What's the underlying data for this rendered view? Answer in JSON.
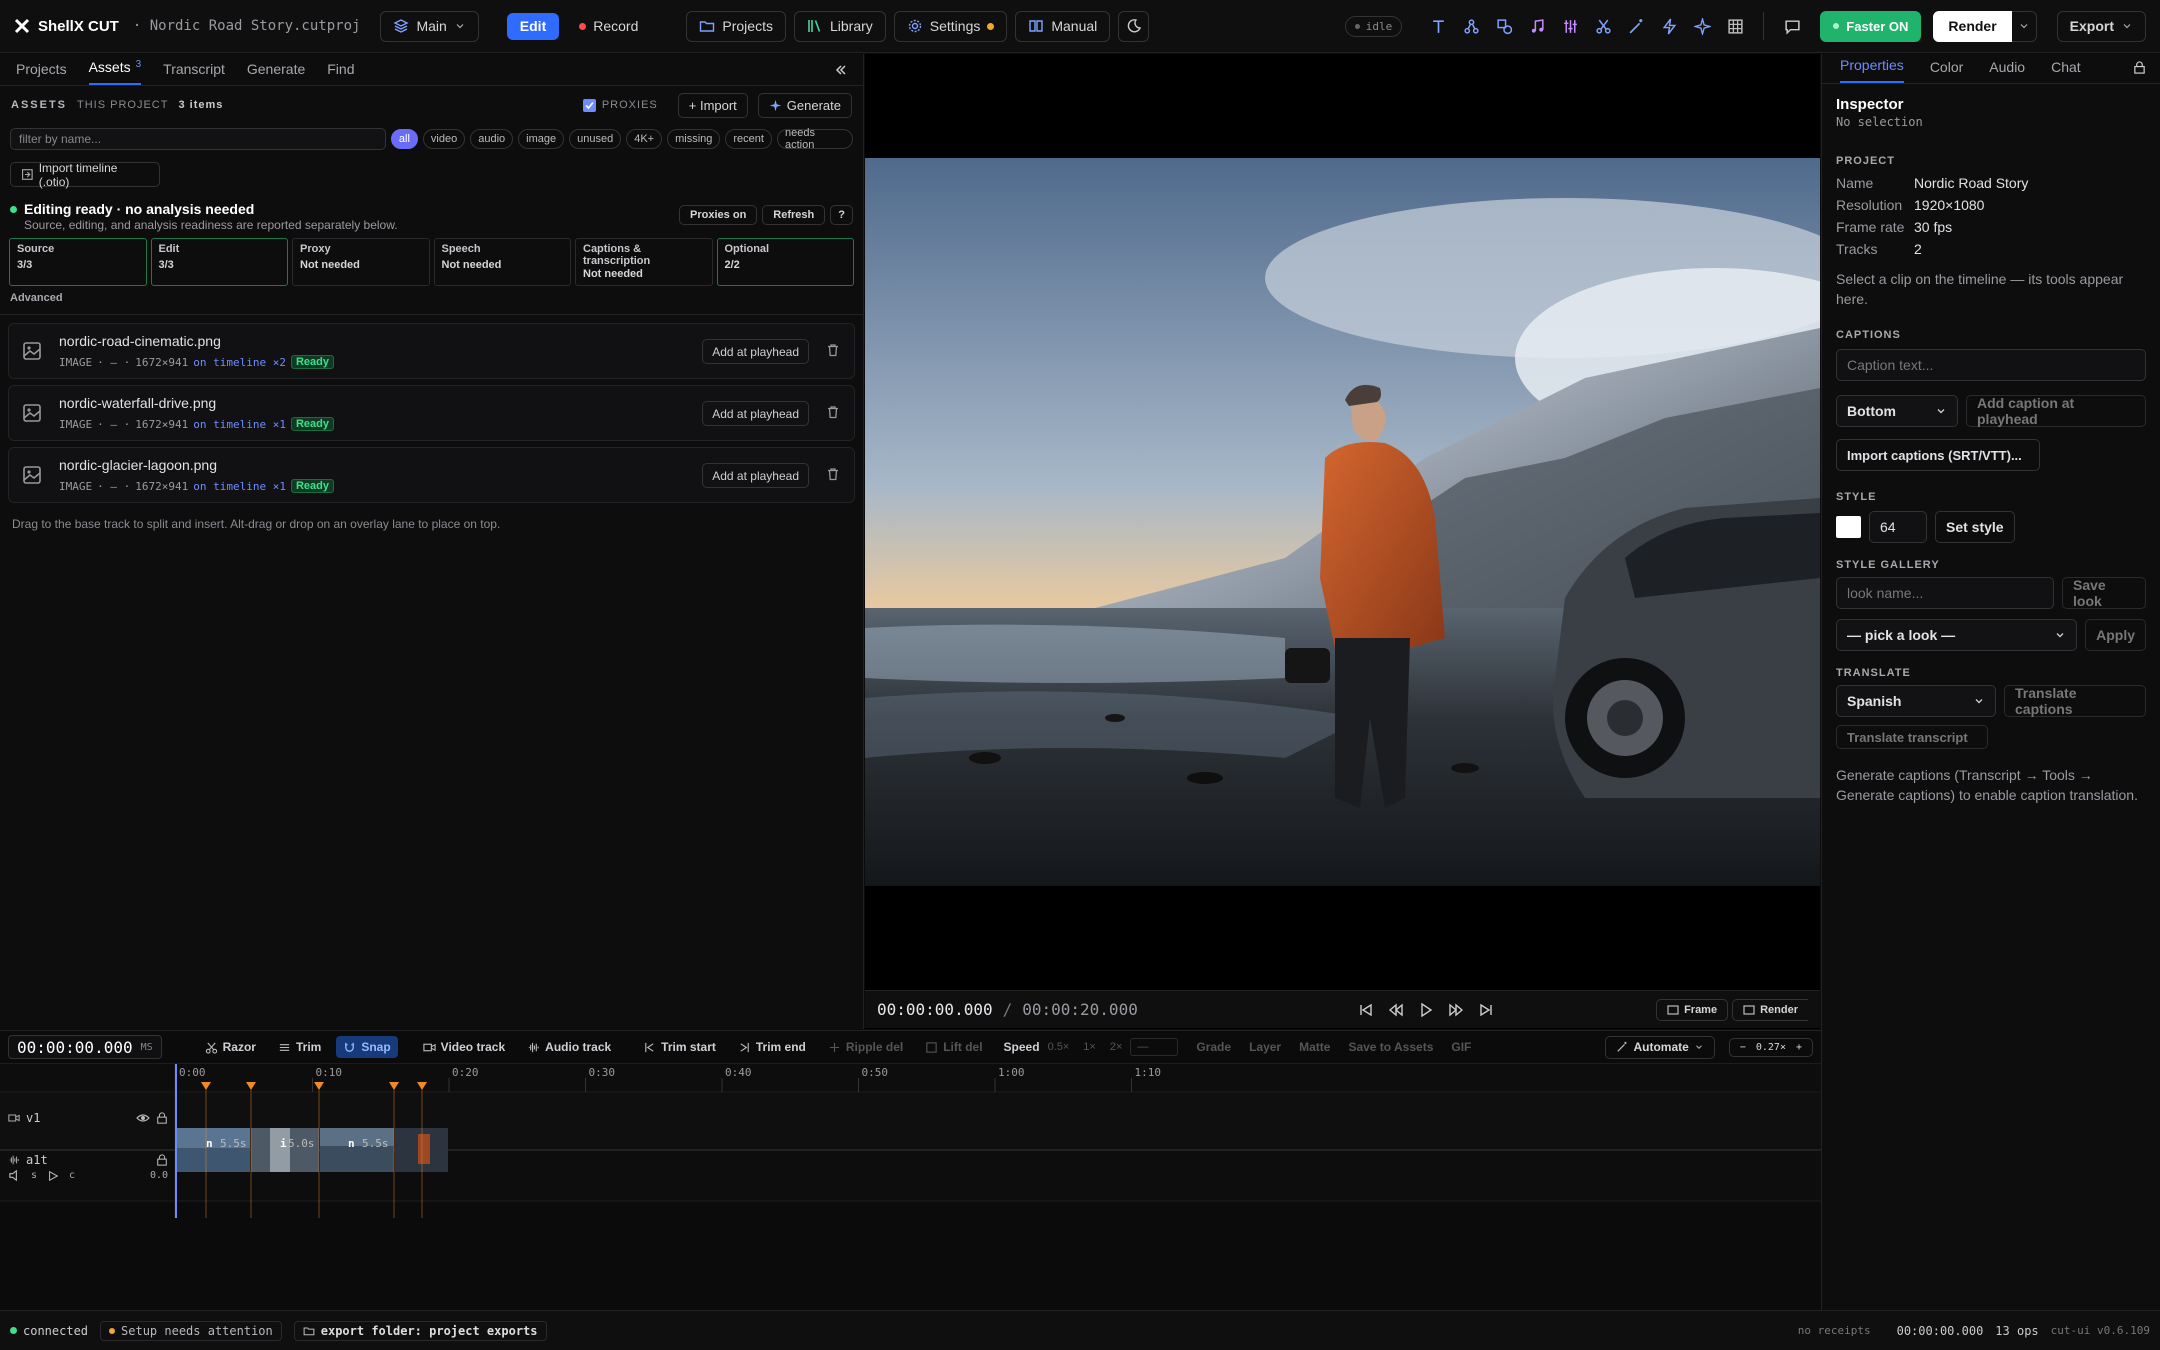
{
  "app": {
    "name": "ShellX CUT",
    "project_file": "· Nordic Road Story.cutproj"
  },
  "topbar": {
    "branch": "Main",
    "mode_edit": "Edit",
    "mode_record": "Record",
    "projects": "Projects",
    "library": "Library",
    "settings": "Settings",
    "manual": "Manual",
    "status": "idle",
    "faster": "Faster ON",
    "render": "Render",
    "export": "Export"
  },
  "left": {
    "tabs": [
      "Projects",
      "Assets",
      "Transcript",
      "Generate",
      "Find"
    ],
    "assets_count": "3",
    "assets_title": "ASSETS",
    "assets_scope": "THIS PROJECT",
    "items_count": "3 items",
    "proxies_label": "PROXIES",
    "import_label": "+ Import",
    "generate_label": "Generate",
    "filter_placeholder": "filter by name...",
    "filters": [
      "all",
      "video",
      "audio",
      "image",
      "unused",
      "4K+",
      "missing",
      "recent",
      "needs action"
    ],
    "import_timeline": "Import timeline (.otio)",
    "ready_title": "Editing ready · no analysis needed",
    "ready_sub": "Source, editing, and analysis readiness are reported separately below.",
    "proxies_on": "Proxies on",
    "refresh": "Refresh",
    "help": "?",
    "cards": [
      {
        "label": "Source",
        "value": "3/3"
      },
      {
        "label": "Edit",
        "value": "3/3"
      },
      {
        "label": "Proxy",
        "value": "Not needed"
      },
      {
        "label": "Speech",
        "value": "Not needed"
      },
      {
        "label": "Captions & transcription",
        "value": "Not needed"
      },
      {
        "label": "Optional",
        "value": "2/2"
      }
    ],
    "advanced": "Advanced",
    "assets": [
      {
        "name": "nordic-road-cinematic.png",
        "kind": "IMAGE",
        "dash": "· — ·",
        "dims": "1672×941",
        "ontl": "on timeline ×2",
        "status": "Ready"
      },
      {
        "name": "nordic-waterfall-drive.png",
        "kind": "IMAGE",
        "dash": "· — ·",
        "dims": "1672×941",
        "ontl": "on timeline ×1",
        "status": "Ready"
      },
      {
        "name": "nordic-glacier-lagoon.png",
        "kind": "IMAGE",
        "dash": "· — ·",
        "dims": "1672×941",
        "ontl": "on timeline ×1",
        "status": "Ready"
      }
    ],
    "add_at_playhead": "Add at playhead",
    "hint": "Drag to the base track to split and insert. Alt-drag or drop on an overlay lane to place on top."
  },
  "viewer": {
    "current": "00:00:00.000",
    "sep": "/",
    "total": "00:00:20.000",
    "frame": "Frame",
    "render": "Render"
  },
  "right": {
    "tabs": [
      "Properties",
      "Color",
      "Audio",
      "Chat"
    ],
    "inspector": "Inspector",
    "no_selection": "No selection",
    "project_title": "PROJECT",
    "project": [
      {
        "k": "Name",
        "v": "Nordic Road Story"
      },
      {
        "k": "Resolution",
        "v": "1920×1080"
      },
      {
        "k": "Frame rate",
        "v": "30 fps"
      },
      {
        "k": "Tracks",
        "v": "2"
      }
    ],
    "select_hint": "Select a clip on the timeline — its tools appear here.",
    "captions_title": "CAPTIONS",
    "caption_placeholder": "Caption text...",
    "position": "Bottom",
    "add_caption": "Add caption at playhead",
    "import_captions": "Import captions (SRT/VTT)...",
    "style_title": "STYLE",
    "style_size": "64",
    "set_style": "Set style",
    "gallery_title": "STYLE GALLERY",
    "look_placeholder": "look name...",
    "save_look": "Save look",
    "pick_look": "— pick a look —",
    "apply": "Apply",
    "translate_title": "TRANSLATE",
    "language": "Spanish",
    "translate_captions": "Translate captions",
    "translate_transcript": "Translate transcript",
    "translate_hint": "Generate captions (Transcript → Tools → Generate captions) to enable caption translation."
  },
  "timeline": {
    "timecode": "00:00:00.000",
    "unit": "MS",
    "tools": [
      "Razor",
      "Trim",
      "Snap",
      "Video track",
      "Audio track",
      "Trim start",
      "Trim end",
      "Ripple del",
      "Lift del"
    ],
    "speed": "Speed",
    "speeds": [
      "0.5×",
      "1×",
      "2×",
      "—"
    ],
    "more": [
      "Grade",
      "Layer",
      "Matte",
      "Save to Assets",
      "GIF"
    ],
    "automate": "Automate",
    "zoom": "0.27×",
    "zoom_minus": "−",
    "zoom_plus": "+",
    "ticks": [
      "0:00",
      "0:10",
      "0:20",
      "0:30",
      "0:40",
      "0:50",
      "1:00",
      "1:10"
    ],
    "v1": "v1",
    "a1": "a1t",
    "a1_s": "s",
    "a1_c": "c",
    "a1_gain": "0.0",
    "clips": [
      {
        "glyph": "n",
        "dur": "5.5s"
      },
      {
        "glyph": "i",
        "dur": "5.0s"
      },
      {
        "glyph": "n",
        "dur": "5.5s"
      },
      {
        "glyph": "",
        "dur": ""
      }
    ]
  },
  "status": {
    "connected": "connected",
    "setup": "Setup needs attention",
    "export_folder": "export folder: project exports",
    "receipts": "no receipts",
    "time": "00:00:00.000",
    "ops": "13 ops",
    "version": "cut-ui v0.6.109"
  },
  "colors": {
    "accent": "#2f6bff",
    "ready": "#3ee08c",
    "faster": "#1fb36b",
    "marker": "#f08a24"
  }
}
